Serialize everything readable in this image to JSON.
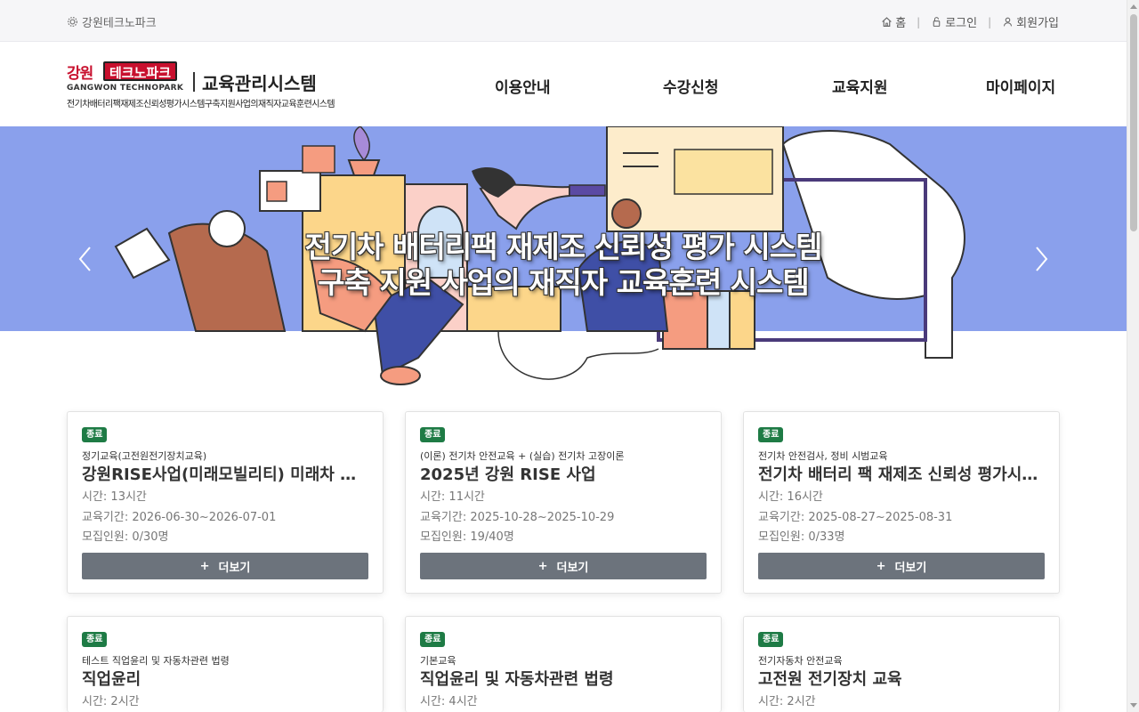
{
  "topbar": {
    "site_name": "강원테크노파크",
    "links": [
      {
        "icon": "home-icon",
        "label": "홈"
      },
      {
        "icon": "lock-icon",
        "label": "로그인"
      },
      {
        "icon": "user-icon",
        "label": "회원가입"
      }
    ],
    "separator": "|"
  },
  "logo": {
    "korean": "강원",
    "brand": "테크노파크",
    "english": "GANGWON TECHNOPARK",
    "system": "교육관리시스템",
    "subtitle": "전기차배터리팩재제조신뢰성평가시스템구축지원사업의재직자교육훈련시스템",
    "brand_color": "#c8102e"
  },
  "nav": [
    "이용안내",
    "수강신청",
    "교육지원",
    "마이페이지"
  ],
  "banner": {
    "line1": "전기차 배터리팩 재제조 신뢰성 평가 시스템",
    "line2": "구축 지원 사업의 재직자 교육훈련 시스템",
    "background": "#8aa0ec"
  },
  "more_label": "더보기",
  "more_icon": "+",
  "cards": [
    {
      "status": "종료",
      "category": "정기교육(고전원전기장치교육)",
      "title": "강원RISE사업(미래모빌리티) 미래차 정비 교육",
      "hours": "시간: 13시간",
      "period": "교육기간: 2026-06-30~2026-07-01",
      "capacity": "모집인원: 0/30명"
    },
    {
      "status": "종료",
      "category": "(이론) 전기차 안전교육 + (실습) 전기차 고장이론",
      "title": "2025년 강원 RISE 사업",
      "hours": "시간: 11시간",
      "period": "교육기간: 2025-10-28~2025-10-29",
      "capacity": "모집인원: 19/40명"
    },
    {
      "status": "종료",
      "category": "전기차 안전검사, 정비 시범교육",
      "title": "전기차 배터리 팩 재제조 신뢰성 평가시스템 교육",
      "hours": "시간: 16시간",
      "period": "교육기간: 2025-08-27~2025-08-31",
      "capacity": "모집인원: 0/33명"
    },
    {
      "status": "종료",
      "category": "테스트 직업윤리 및 자동차관련 법령",
      "title": "직업윤리",
      "hours": "시간: 2시간"
    },
    {
      "status": "종료",
      "category": "기본교육",
      "title": "직업윤리 및 자동차관련 법령",
      "hours": "시간: 4시간"
    },
    {
      "status": "종료",
      "category": "전기자동차 안전교육",
      "title": "고전원 전기장치 교육",
      "hours": "시간: 2시간"
    }
  ],
  "status_color": "#1e7b45"
}
